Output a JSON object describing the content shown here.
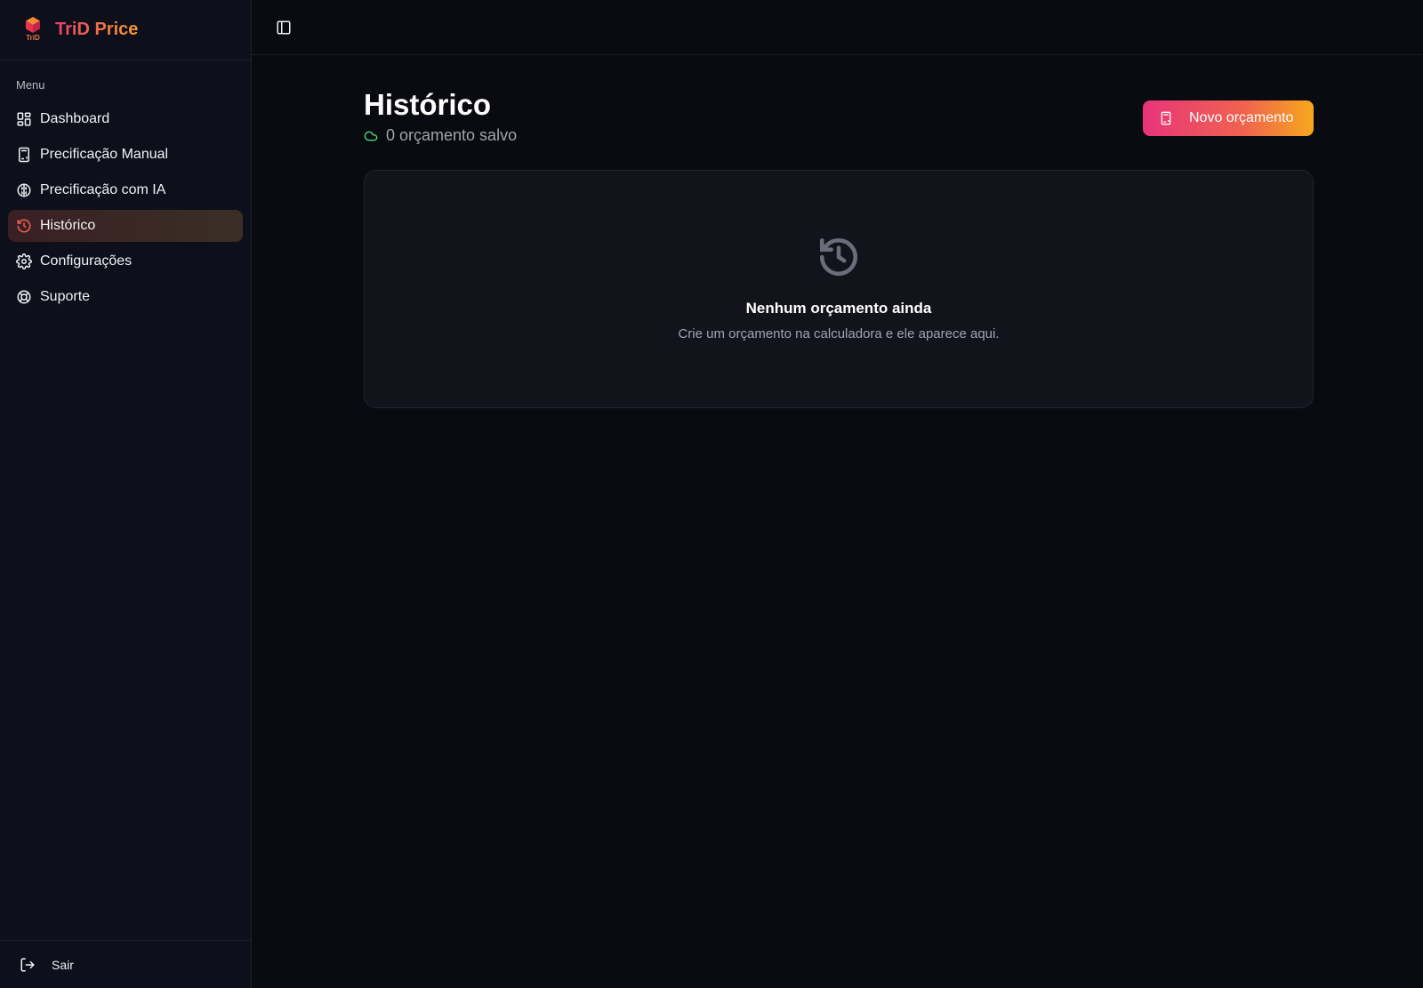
{
  "brand": {
    "name": "TriD Price",
    "logo_text": "TriD",
    "colors": {
      "start": "#e83e6c",
      "end": "#f59a2c"
    }
  },
  "sidebar": {
    "heading": "Menu",
    "items": [
      {
        "label": "Dashboard",
        "icon": "dashboard-icon"
      },
      {
        "label": "Precificação Manual",
        "icon": "calculator-icon"
      },
      {
        "label": "Precificação com IA",
        "icon": "brain-icon"
      },
      {
        "label": "Histórico",
        "icon": "history-icon",
        "active": true
      },
      {
        "label": "Configurações",
        "icon": "gear-icon"
      },
      {
        "label": "Suporte",
        "icon": "lifebuoy-icon"
      }
    ],
    "logout_label": "Sair"
  },
  "page": {
    "title": "Histórico",
    "subtitle": "0 orçamento salvo",
    "new_button_label": "Novo orçamento",
    "empty_title": "Nenhum orçamento ainda",
    "empty_desc": "Crie um orçamento na calculadora e ele aparece aqui."
  }
}
